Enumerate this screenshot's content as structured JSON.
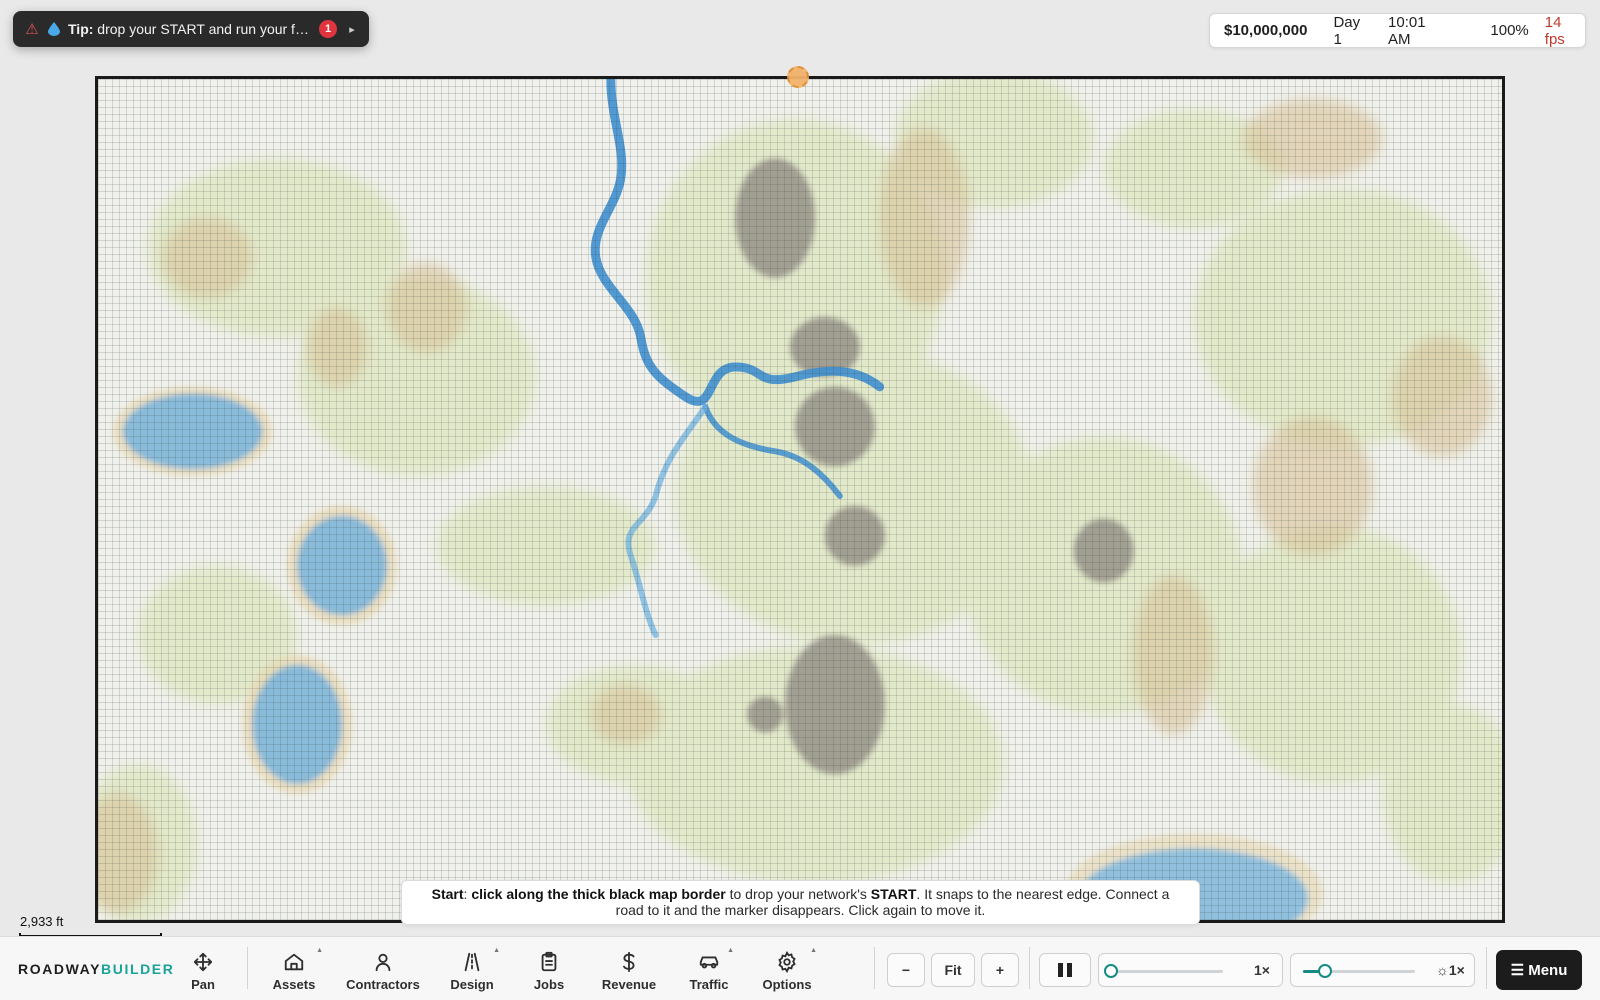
{
  "tip": {
    "label": "Tip:",
    "text": "drop your START and run your first...",
    "badge": "1",
    "warn_icon": "warning-icon",
    "expand_icon": "play-right-icon"
  },
  "status": {
    "money": "$10,000,000",
    "day": "Day 1",
    "time": "10:01 AM",
    "zoom": "100%",
    "fps": "14 fps",
    "fps_color": "#c0392b"
  },
  "scale": {
    "label": "2,933 ft"
  },
  "instruction": {
    "p1": "Start",
    "p2": ": ",
    "p3": "click along the thick black map border",
    "p4": " to drop your network's ",
    "p5": "START",
    "p6": ". It snaps to the nearest edge. Connect a road to it and the marker disappears. Click again to move it."
  },
  "brand": {
    "part1": "ROADWAY",
    "part2": "BUILDER",
    "accent": "#1aa39a"
  },
  "toolbar": [
    {
      "label": "Pan",
      "icon": "move-arrows-icon"
    },
    {
      "label": "Assets",
      "icon": "home-icon"
    },
    {
      "label": "Contractors",
      "icon": "person-icon"
    },
    {
      "label": "Design",
      "icon": "road-icon"
    },
    {
      "label": "Jobs",
      "icon": "clipboard-icon"
    },
    {
      "label": "Revenue",
      "icon": "dollar-icon"
    },
    {
      "label": "Traffic",
      "icon": "car-icon"
    },
    {
      "label": "Options",
      "icon": "gear-icon"
    }
  ],
  "zoom_controls": {
    "minus": "−",
    "fit": "Fit",
    "plus": "+"
  },
  "playback": {
    "pause_icon": "pause-icon",
    "speed_label": "1×",
    "speed_level": 0,
    "light_label": "☼1×",
    "light_level": 0.2
  },
  "menu": {
    "label": "☰ Menu"
  }
}
